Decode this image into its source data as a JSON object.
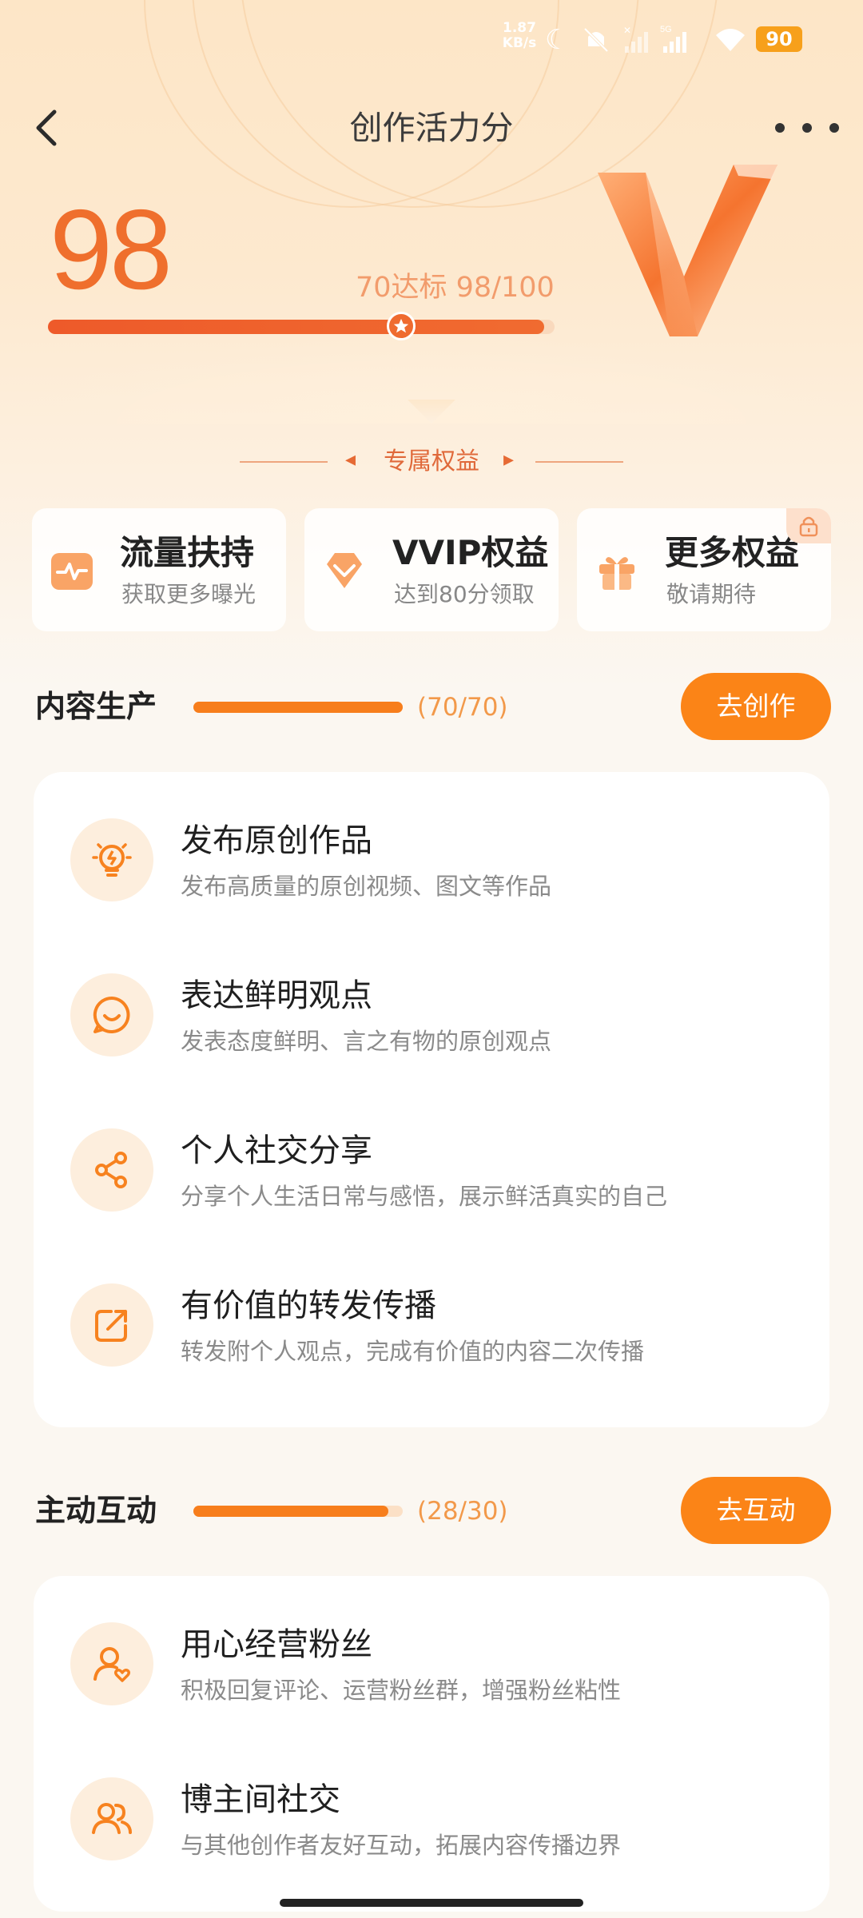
{
  "status_bar": {
    "speed": "1.87 KB/s",
    "network": "5G",
    "battery": "90",
    "icons": [
      "moon-icon",
      "mute-icon",
      "no-signal-icon",
      "signal-icon",
      "wifi-icon",
      "battery-icon"
    ]
  },
  "header": {
    "title": "创作活力分",
    "back_icon": "back-arrow-icon",
    "more_icon": "more-dots-icon"
  },
  "score": {
    "value": "98",
    "target_text": "70达标 98/100",
    "progress_fraction": 0.98,
    "target_fraction": 0.7
  },
  "rights": {
    "label": "专属权益"
  },
  "benefits": [
    {
      "title": "流量扶持",
      "subtitle": "获取更多曝光",
      "icon": "pulse-icon"
    },
    {
      "title": "VVIP权益",
      "subtitle": "达到80分领取",
      "icon": "diamond-icon"
    },
    {
      "title": "更多权益",
      "subtitle": "敬请期待",
      "icon": "gift-icon",
      "badge_icon": "lock-icon"
    }
  ],
  "sections": [
    {
      "title": "内容生产",
      "count": "(70/70)",
      "progress_fraction": 1.0,
      "action": "去创作",
      "tasks": [
        {
          "title": "发布原创作品",
          "desc": "发布高质量的原创视频、图文等作品",
          "icon": "lightbulb-icon"
        },
        {
          "title": "表达鲜明观点",
          "desc": "发表态度鲜明、言之有物的原创观点",
          "icon": "chat-smile-icon"
        },
        {
          "title": "个人社交分享",
          "desc": "分享个人生活日常与感悟，展示鲜活真实的自己",
          "icon": "share-icon"
        },
        {
          "title": "有价值的转发传播",
          "desc": "转发附个人观点，完成有价值的内容二次传播",
          "icon": "forward-icon"
        }
      ]
    },
    {
      "title": "主动互动",
      "count": "(28/30)",
      "progress_fraction": 0.933,
      "action": "去互动",
      "tasks": [
        {
          "title": "用心经营粉丝",
          "desc": "积极回复评论、运营粉丝群，增强粉丝粘性",
          "icon": "user-heart-icon"
        },
        {
          "title": "博主间社交",
          "desc": "与其他创作者友好互动，拓展内容传播边界",
          "icon": "users-icon"
        }
      ]
    }
  ],
  "colors": {
    "accent": "#fb8417",
    "score": "#ef6f2d",
    "icon_bg": "#fdeedd"
  }
}
